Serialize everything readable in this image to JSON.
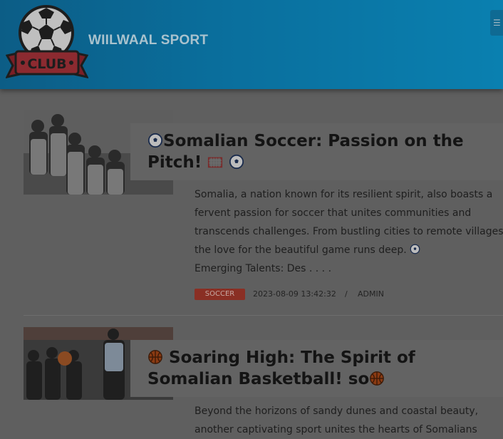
{
  "site": {
    "title": "WIILWAAL SPORT",
    "logo_text": "CLUB",
    "menu_icon": "menu-icon"
  },
  "posts": [
    {
      "title_icon_before": "soccer-ball-icon",
      "title": "Somalian Soccer: Passion on the Pitch!",
      "title_icons_after": [
        "goal-net-icon",
        "soccer-ball-icon"
      ],
      "excerpt": "Somalia, a nation known for its resilient spirit, also boasts a fervent passion for soccer that unites communities and transcends challenges. From bustling cities to remote villages, the love for the beautiful game runs deep.",
      "excerpt_icon": "soccer-ball-icon",
      "excerpt_tail": "Emerging Talents: Des . . . .",
      "category": "SOCCER",
      "date": "2023-08-09 13:42:32",
      "separator": "/",
      "author": "ADMIN"
    },
    {
      "title_icon_before": "basketball-icon",
      "title": "Soaring High: The Spirit of Somalian Basketball! so",
      "title_icons_after": [
        "basketball-icon"
      ],
      "excerpt": "Beyond the horizons of sandy dunes and coastal beauty, another captivating sport unites the hearts of Somalians"
    }
  ],
  "colors": {
    "header": "#0a6f9d",
    "badge": "#8a2f24",
    "overlay_background": "#5f5f5f"
  }
}
